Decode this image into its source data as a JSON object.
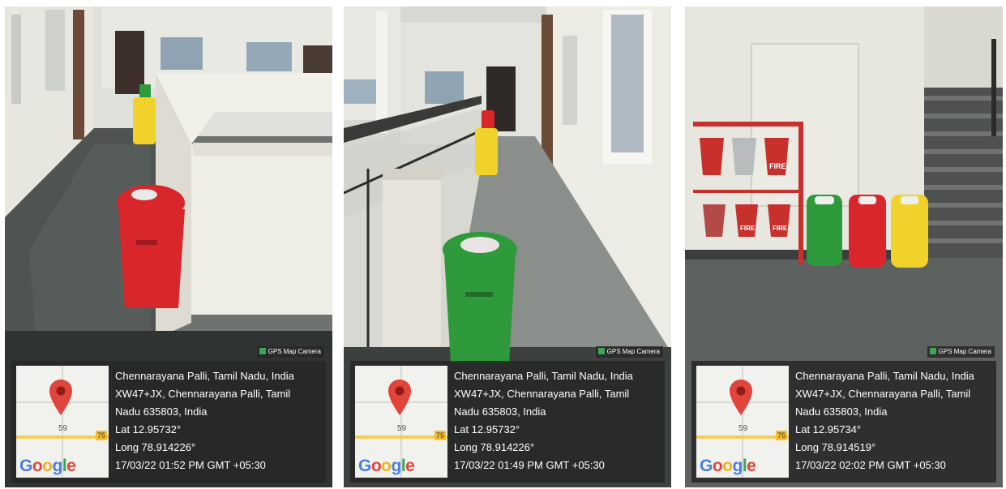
{
  "photos": [
    {
      "camera_badge": "GPS Map Camera",
      "location_title": "Chennarayana Palli, Tamil Nadu, India",
      "address_line1": "XW47+JX, Chennarayana Palli, Tamil",
      "address_line2": "Nadu 635803, India",
      "latitude": "Lat 12.95732°",
      "longitude": "Long 78.914226°",
      "timestamp": "17/03/22 01:52 PM GMT +05:30",
      "map_label_left": "59",
      "map_label_right": "75"
    },
    {
      "camera_badge": "GPS Map Camera",
      "location_title": "Chennarayana Palli, Tamil Nadu, India",
      "address_line1": "XW47+JX, Chennarayana Palli, Tamil",
      "address_line2": "Nadu 635803, India",
      "latitude": "Lat 12.95732°",
      "longitude": "Long 78.914226°",
      "timestamp": "17/03/22 01:49 PM GMT +05:30",
      "map_label_left": "59",
      "map_label_right": "75"
    },
    {
      "camera_badge": "GPS Map Camera",
      "location_title": "Chennarayana Palli, Tamil Nadu, India",
      "address_line1": "XW47+JX, Chennarayana Palli, Tamil",
      "address_line2": "Nadu 635803, India",
      "latitude": "Lat 12.95734°",
      "longitude": "Long 78.914519°",
      "timestamp": "17/03/22 02:02 PM GMT +05:30",
      "map_label_left": "59",
      "map_label_right": "75"
    }
  ],
  "map_logo": [
    "G",
    "o",
    "o",
    "g",
    "l",
    "e"
  ],
  "bucket_label": "FIRE",
  "colors": {
    "bin_red": "#d8262b",
    "bin_green": "#2f9a3c",
    "bin_yellow": "#f0d22a",
    "bucket_red": "#c8302d",
    "pin_red": "#e0443a"
  }
}
